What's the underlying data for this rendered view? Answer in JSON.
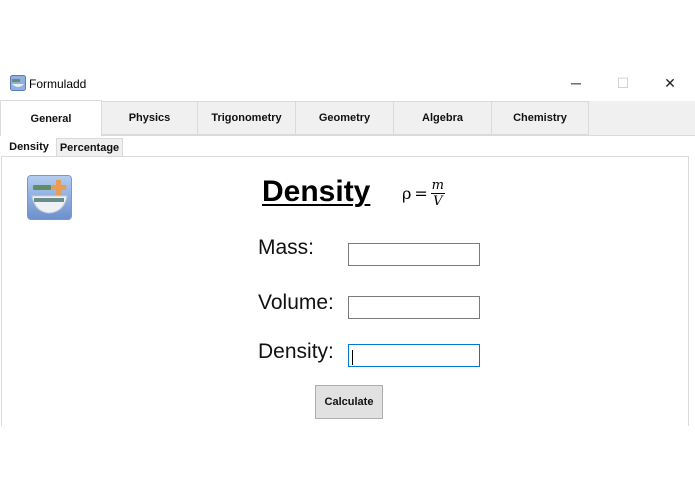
{
  "window": {
    "title": "Formuladd",
    "controls": {
      "minimize": "─",
      "maximize": "☐",
      "close": "✕"
    }
  },
  "main_tabs": [
    "General",
    "Physics",
    "Trigonometry",
    "Geometry",
    "Algebra",
    "Chemistry"
  ],
  "active_main_tab": "General",
  "sub_tabs": [
    "Density",
    "Percentage"
  ],
  "active_sub_tab": "Density",
  "content": {
    "logo_icon": "formula-app-logo-icon",
    "heading": "Density",
    "formula": {
      "lhs": "ρ",
      "eq": "=",
      "numerator": "m",
      "denominator": "V"
    },
    "fields": [
      {
        "label": "Mass:",
        "value": ""
      },
      {
        "label": "Volume:",
        "value": ""
      },
      {
        "label": "Density:",
        "value": ""
      }
    ],
    "calculate_label": "Calculate"
  },
  "colors": {
    "tab_bar": "#f0f0f0",
    "border": "#dadada",
    "focus": "#0078d7",
    "button": "#e1e1e1"
  }
}
